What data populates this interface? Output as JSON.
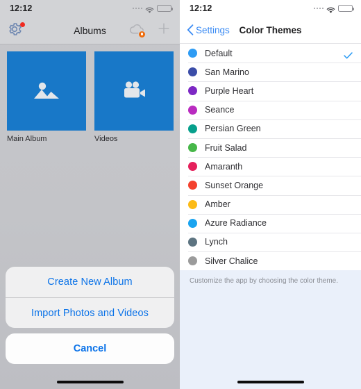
{
  "left_screen": {
    "status_bar": {
      "time": "12:12",
      "signal_icon": "signal-dots-icon",
      "wifi_icon": "wifi-icon",
      "battery_icon": "battery-low-power-icon"
    },
    "nav": {
      "title": "Albums",
      "settings_icon": "gear-icon",
      "settings_badge_color": "#f02a20",
      "cloud_icon": "cloud-sync-icon",
      "cloud_badge_color": "#ee6b0c",
      "add_icon": "plus-icon"
    },
    "albums": [
      {
        "label": "Main Album",
        "icon": "photo-mountain-icon",
        "tile_color": "#1878c8"
      },
      {
        "label": "Videos",
        "icon": "video-camera-icon",
        "tile_color": "#1878c8"
      }
    ],
    "action_sheet": {
      "options": [
        "Create New Album",
        "Import Photos and Videos"
      ],
      "cancel_label": "Cancel",
      "tint_color": "#0a72e8"
    },
    "home_indicator": "home-indicator"
  },
  "right_screen": {
    "status_bar": {
      "time": "12:12",
      "signal_icon": "signal-dots-icon",
      "wifi_icon": "wifi-icon",
      "battery_icon": "battery-low-power-icon"
    },
    "nav": {
      "back_label": "Settings",
      "back_icon": "chevron-left-icon",
      "title": "Color Themes"
    },
    "themes": [
      {
        "name": "Default",
        "color": "#2e9cf4",
        "selected": true
      },
      {
        "name": "San Marino",
        "color": "#3b4da8",
        "selected": false
      },
      {
        "name": "Purple Heart",
        "color": "#7d28c4",
        "selected": false
      },
      {
        "name": "Seance",
        "color": "#b92bc0",
        "selected": false
      },
      {
        "name": "Persian Green",
        "color": "#07a08c",
        "selected": false
      },
      {
        "name": "Fruit Salad",
        "color": "#47b749",
        "selected": false
      },
      {
        "name": "Amaranth",
        "color": "#e5215c",
        "selected": false
      },
      {
        "name": "Sunset Orange",
        "color": "#f4412e",
        "selected": false
      },
      {
        "name": "Amber",
        "color": "#fcbb17",
        "selected": false
      },
      {
        "name": "Azure Radiance",
        "color": "#1aa4f0",
        "selected": false
      },
      {
        "name": "Lynch",
        "color": "#5d7481",
        "selected": false
      },
      {
        "name": "Silver Chalice",
        "color": "#9b9b9b",
        "selected": false
      }
    ],
    "footer_note": "Customize the app by choosing the color theme.",
    "check_icon": "checkmark-icon",
    "check_color": "#2e9cf4",
    "home_indicator": "home-indicator"
  }
}
